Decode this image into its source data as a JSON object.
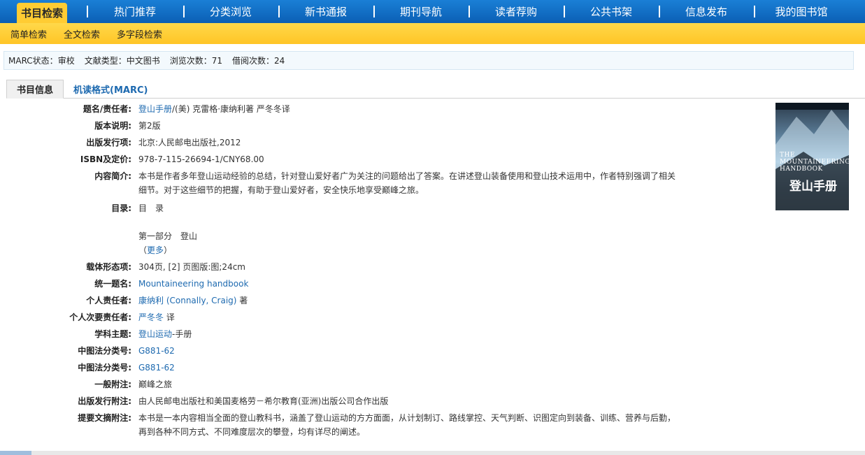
{
  "topnav": {
    "items": [
      {
        "label": "书目检索"
      },
      {
        "label": "热门推荐"
      },
      {
        "label": "分类浏览"
      },
      {
        "label": "新书通报"
      },
      {
        "label": "期刊导航"
      },
      {
        "label": "读者荐购"
      },
      {
        "label": "公共书架"
      },
      {
        "label": "信息发布"
      },
      {
        "label": "我的图书馆"
      }
    ]
  },
  "subnav": {
    "items": [
      {
        "label": "简单检索"
      },
      {
        "label": "全文检索"
      },
      {
        "label": "多字段检索"
      }
    ]
  },
  "status": {
    "marc_label": "MARC状态：",
    "marc_value": "审校",
    "type_label": "文献类型：",
    "type_value": "中文图书",
    "views_label": "浏览次数：",
    "views_value": "71",
    "loans_label": "借阅次数：",
    "loans_value": "24"
  },
  "tabs": {
    "info": "书目信息",
    "marc": "机读格式(MARC)"
  },
  "record": {
    "title": {
      "label": "题名/责任者:",
      "link": "登山手册",
      "rest": "/(美) 克雷格·康纳利著 严冬冬译"
    },
    "edition": {
      "label": "版本说明:",
      "value": "第2版"
    },
    "publish": {
      "label": "出版发行项:",
      "value": "北京:人民邮电出版社,2012"
    },
    "isbn": {
      "label": "ISBN及定价:",
      "value": "978-7-115-26694-1/CNY68.00"
    },
    "summary": {
      "label": "内容简介:",
      "line1": "本书是作者多年登山运动经验的总结，针对登山爱好者广为关注的问题给出了答案。在讲述登山装备使用和登山技术运用中，作者特别强调了相关",
      "line2": "细节。对于这些细节的把握，有助于登山爱好者，安全快乐地享受巅峰之旅。"
    },
    "toc": {
      "label": "目录:",
      "line1": "目　录",
      "line2": "第一部分　登山",
      "more_open": "（",
      "more": "更多",
      "more_close": "）"
    },
    "physical": {
      "label": "载体形态项:",
      "value": "304页, [2] 页图版:图;24cm"
    },
    "uniform": {
      "label": "统一题名:",
      "link": "Mountaineering handbook"
    },
    "author": {
      "label": "个人责任者:",
      "link": "康纳利 (Connally, Craig)",
      "rest": " 著"
    },
    "translator": {
      "label": "个人次要责任者:",
      "link": "严冬冬",
      "rest": " 译"
    },
    "subject": {
      "label": "学科主题:",
      "link": "登山运动",
      "rest": "-手册"
    },
    "clc1": {
      "label": "中图法分类号:",
      "link": "G881-62"
    },
    "clc2": {
      "label": "中图法分类号:",
      "link": "G881-62"
    },
    "note": {
      "label": "一般附注:",
      "value": "巅峰之旅"
    },
    "pubnote": {
      "label": "出版发行附注:",
      "value": "由人民邮电出版社和美国麦格劳－希尔教育(亚洲)出版公司合作出版"
    },
    "abstract": {
      "label": "提要文摘附注:",
      "line1": "本书是一本内容相当全面的登山教科书，涵盖了登山运动的方方面面，从计划制订、路线掌控、天气判断、识图定向到装备、训练、营养与后勤，",
      "line2": "再到各种不同方式、不同难度层次的攀登，均有详尽的阐述。"
    }
  },
  "cover": {
    "en_title": "THE MOUNTAINEERING HANDBOOK",
    "cn_title": "登山手册"
  },
  "colors": {
    "nav_blue": "#0b5fb4",
    "nav_yellow": "#ffcc33",
    "link": "#1e6ab0"
  }
}
